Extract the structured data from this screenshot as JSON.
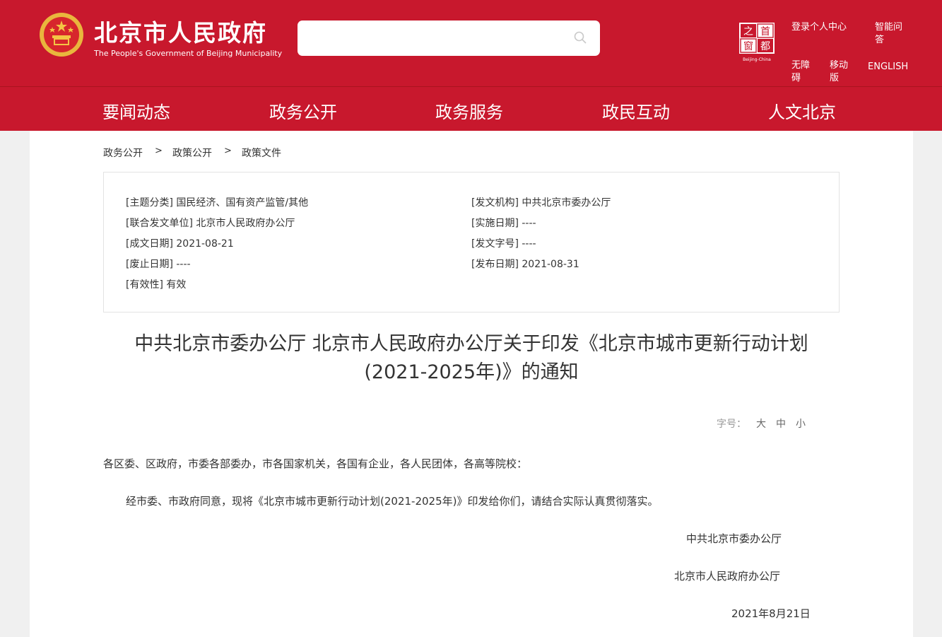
{
  "header": {
    "site_title": "北京市人民政府",
    "site_subtitle": "The People's Government of Beijing Municipality",
    "search_placeholder": "",
    "capital_logo_text": "首都之窗",
    "capital_logo_sub": "Beijing-China",
    "links": {
      "login": "登录个人中心",
      "smart_qa": "智能问答",
      "accessibility": "无障碍",
      "mobile": "移动版",
      "english": "ENGLISH"
    }
  },
  "nav": [
    "要闻动态",
    "政务公开",
    "政务服务",
    "政民互动",
    "人文北京"
  ],
  "breadcrumb": [
    "政务公开",
    "政策文件"
  ],
  "breadcrumb_home": "政务公开",
  "breadcrumb_mid": "政策公开",
  "breadcrumb_leaf": "政策文件",
  "breadcrumb_sep": ">",
  "meta": {
    "topic": "[主题分类] 国民经济、国有资产监管/其他",
    "joint_issuer": "[联合发文单位] 北京市人民政府办公厅",
    "written_date": "[成文日期] 2021-08-21",
    "repeal_date": "[废止日期] ----",
    "validity": "[有效性] 有效",
    "issuer": "[发文机构] 中共北京市委办公厅",
    "effective_date": "[实施日期] ----",
    "doc_number": "[发文字号] ----",
    "publish_date": "[发布日期] 2021-08-31"
  },
  "document": {
    "title_line1": "中共北京市委办公厅 北京市人民政府办公厅关于印发《北京市城市更新行动计划",
    "title_line2": "(2021-2025年)》的通知",
    "font_size_label": "字号：",
    "font_size_options": [
      "大",
      "中",
      "小"
    ],
    "salutation": "各区委、区政府，市委各部委办，市各国家机关，各国有企业，各人民团体，各高等院校：",
    "body": "经市委、市政府同意，现将《北京市城市更新行动计划(2021-2025年)》印发给你们，请结合实际认真贯彻落实。",
    "signature_1": "中共北京市委办公厅",
    "signature_2": "北京市人民政府办公厅",
    "date": "2021年8月21日"
  },
  "colors": {
    "brand_red": "#c8182d",
    "emblem_gold": "#f3c544"
  }
}
